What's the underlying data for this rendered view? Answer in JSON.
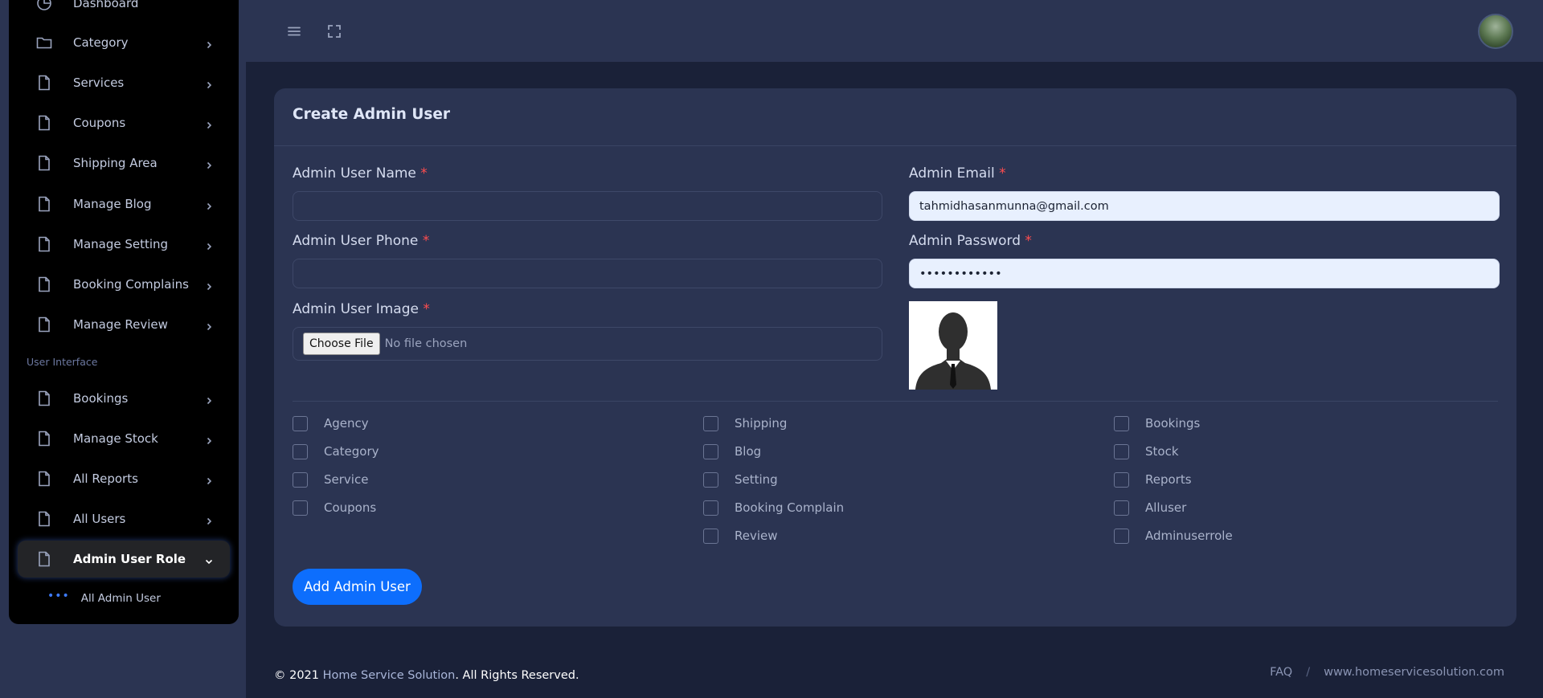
{
  "sidebar": {
    "items": [
      {
        "label": "Dashboard",
        "icon": "dashboard-icon"
      },
      {
        "label": "Category",
        "icon": "folder-icon"
      },
      {
        "label": "Services",
        "icon": "file-icon"
      },
      {
        "label": "Coupons",
        "icon": "file-icon"
      },
      {
        "label": "Shipping Area",
        "icon": "file-icon"
      },
      {
        "label": "Manage Blog",
        "icon": "file-icon"
      },
      {
        "label": "Manage Setting",
        "icon": "file-icon"
      },
      {
        "label": "Booking Complains",
        "icon": "file-icon"
      },
      {
        "label": "Manage Review",
        "icon": "file-icon"
      }
    ],
    "section_label": "User Interface",
    "items2": [
      {
        "label": "Bookings",
        "icon": "file-icon"
      },
      {
        "label": "Manage Stock",
        "icon": "file-icon"
      },
      {
        "label": "All Reports",
        "icon": "file-icon"
      },
      {
        "label": "All Users",
        "icon": "file-icon"
      },
      {
        "label": "Admin User Role",
        "icon": "file-icon",
        "active": true
      }
    ],
    "sub_item": {
      "label": "All Admin User",
      "dots": "•••"
    }
  },
  "topbar": {
    "menu_icon": "hamburger-icon",
    "fullscreen_icon": "fullscreen-icon",
    "avatar": "user-avatar"
  },
  "form": {
    "title": "Create Admin User",
    "required_mark": "*",
    "name_label": "Admin User Name",
    "name_value": "",
    "email_label": "Admin Email",
    "email_value": "tahmidhasanmunna@gmail.com",
    "phone_label": "Admin User Phone",
    "phone_value": "",
    "password_label": "Admin Password",
    "password_value": "••••••••••••",
    "image_label": "Admin User Image",
    "file_button": "Choose File",
    "file_status": "No file chosen",
    "preview_icon": "businessman-silhouette-icon",
    "permissions": [
      [
        "Agency",
        "Category",
        "Service",
        "Coupons"
      ],
      [
        "Shipping",
        "Blog",
        "Setting",
        "Booking Complain",
        "Review"
      ],
      [
        "Bookings",
        "Stock",
        "Reports",
        "Alluser",
        "Adminuserrole"
      ]
    ],
    "submit_label": "Add Admin User"
  },
  "footer": {
    "prefix": "© 2021 ",
    "brand": "Home Service Solution",
    "suffix": ". All Rights Reserved.",
    "links": [
      "FAQ",
      "www.homeservicesolution.com"
    ],
    "separator": "/"
  },
  "colors": {
    "accent": "#0d6efd",
    "required": "#ff4d4f",
    "sidebar": "#000000",
    "card": "#2b3452"
  }
}
